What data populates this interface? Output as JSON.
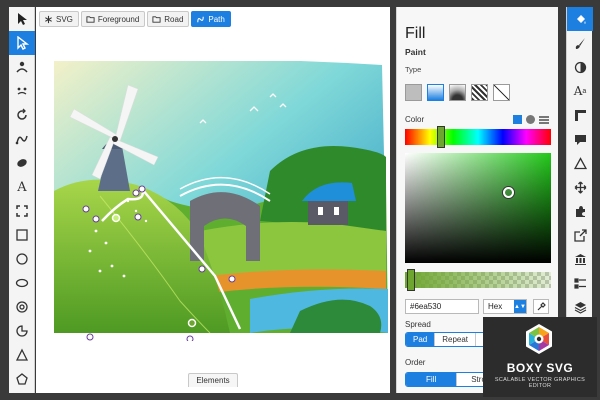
{
  "breadcrumb": [
    {
      "label": "SVG",
      "icon": "asterisk-icon",
      "active": false
    },
    {
      "label": "Foreground",
      "icon": "folder-icon",
      "active": false
    },
    {
      "label": "Road",
      "icon": "folder-icon",
      "active": false
    },
    {
      "label": "Path",
      "icon": "path-icon",
      "active": true
    }
  ],
  "left_tools": [
    "pointer-icon",
    "node-select-icon",
    "person-icon",
    "face-icon",
    "rotate-icon",
    "freehand-icon",
    "blob-icon",
    "text-icon",
    "crop-icon",
    "rectangle-icon",
    "ellipse-icon",
    "ring-icon",
    "circle-icon",
    "pie-icon",
    "triangle-icon",
    "pentagon-icon"
  ],
  "panel": {
    "title": "Fill",
    "paint_label": "Paint",
    "type_label": "Type",
    "color_label": "Color",
    "hex_value": "#6ea530",
    "format": "Hex",
    "spread_label": "Spread",
    "spread_options": [
      "Pad",
      "Repeat",
      "Refl"
    ],
    "spread_selected": "Pad",
    "order_label": "Order",
    "order_options": [
      "Fill",
      "Strok"
    ],
    "order_selected": "Fill"
  },
  "colors": {
    "accent": "#1d7fe0",
    "selected_fill": "#6ea530"
  },
  "right_tools": [
    "paint-bucket-icon",
    "brush-icon",
    "contrast-icon",
    "typography-icon",
    "ruler-icon",
    "comment-icon",
    "triangle-outline-icon",
    "move-arrows-icon",
    "puzzle-icon",
    "export-icon",
    "library-icon",
    "list-icon",
    "layers-icon"
  ],
  "elements_tab": "Elements",
  "logo": {
    "name": "BOXY SVG",
    "tagline": "SCALABLE VECTOR GRAPHICS EDITOR"
  }
}
